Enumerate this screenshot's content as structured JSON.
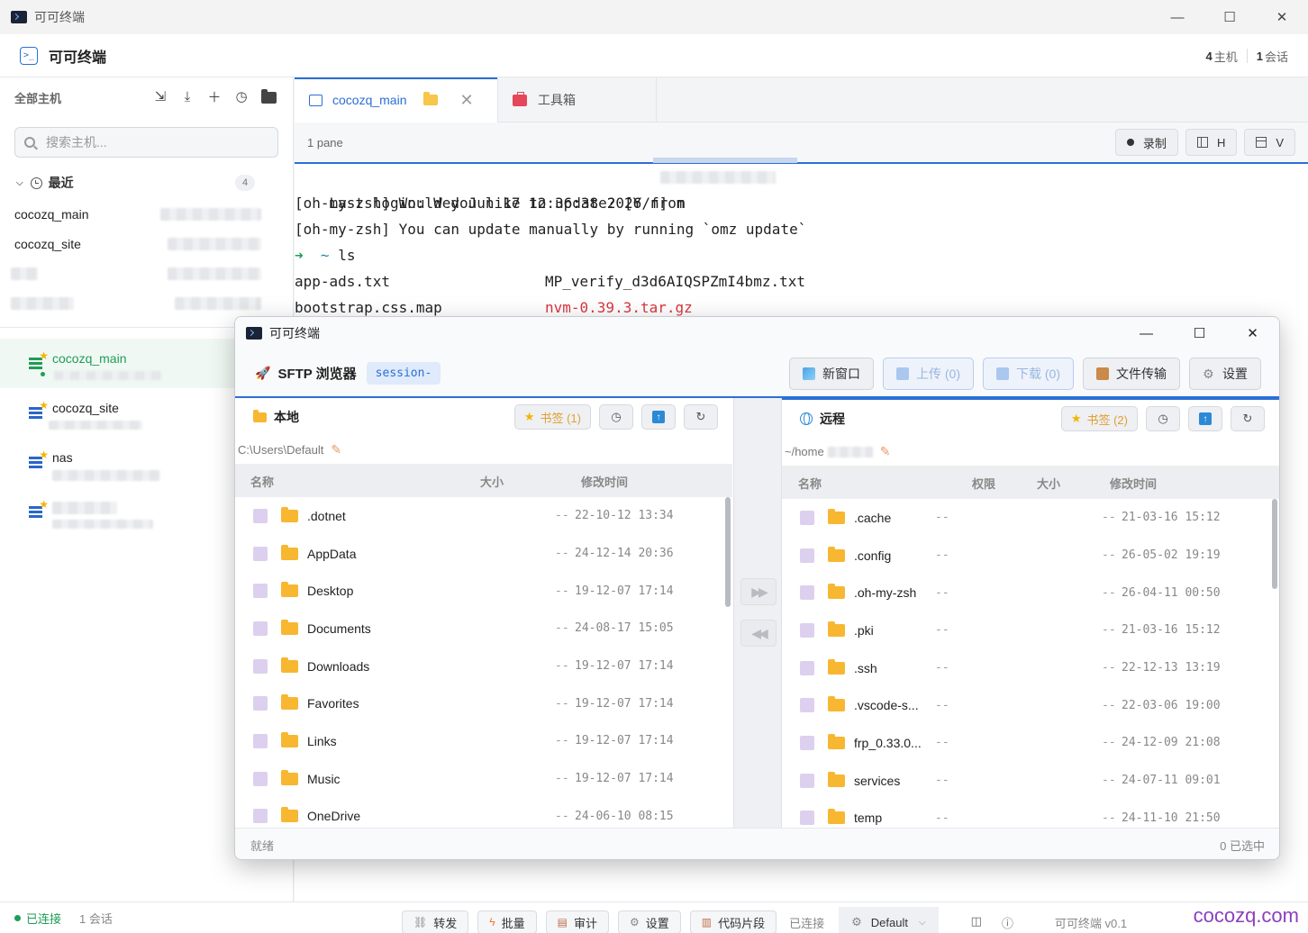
{
  "os": {
    "title": "可可终端",
    "minimize": "—",
    "maximize": "☐",
    "close": "✕"
  },
  "header": {
    "title": "可可终端",
    "hosts_count": "4",
    "hosts_label": "主机",
    "sessions_count": "1",
    "sessions_label": "会话"
  },
  "sidebar": {
    "title": "全部主机",
    "search_placeholder": "搜索主机...",
    "recent": {
      "label": "最近",
      "count": "4",
      "items": [
        "cocozq_main",
        "cocozq_site"
      ]
    },
    "hosts": [
      {
        "name": "cocozq_main"
      },
      {
        "name": "cocozq_site"
      },
      {
        "name": "nas"
      }
    ]
  },
  "tabs": [
    {
      "label": "cocozq_main"
    },
    {
      "label": "工具箱"
    }
  ],
  "panebar": {
    "label": "1 pane",
    "record": "录制",
    "h": "H",
    "v": "V"
  },
  "terminal": {
    "lines": [
      "Last login: Wed Jun 17 12:36:38 2026 from",
      "[oh-my-zsh] Would you like to update? [Y/n] n",
      "[oh-my-zsh] You can update manually by running `omz update`"
    ],
    "prompt_arrow": "➜",
    "prompt_dir": "~",
    "prompt_cmd": "ls",
    "files": [
      {
        "a": "app-ads.txt",
        "b": "MP_verify_d3d6AIQSPZmI4bmz.txt",
        "b_red": false
      },
      {
        "a": "bootstrap.css.map",
        "b": "nvm-0.39.3.tar.gz",
        "b_red": true
      }
    ]
  },
  "sftp": {
    "window_title": "可可终端",
    "title": "SFTP 浏览器",
    "session_badge": "session-",
    "actions": {
      "new_window": "新窗口",
      "upload": "上传 (0)",
      "download": "下载 (0)",
      "transfer": "文件传输",
      "settings": "设置"
    },
    "local": {
      "label": "本地",
      "bookmarks": "书签 (1)",
      "path": "C:\\Users\\Default",
      "cols": {
        "name": "名称",
        "size": "大小",
        "mtime": "修改时间"
      },
      "rows": [
        {
          "name": ".dotnet",
          "size": "--",
          "mtime": "22-10-12 13:34"
        },
        {
          "name": "AppData",
          "size": "--",
          "mtime": "24-12-14 20:36"
        },
        {
          "name": "Desktop",
          "size": "--",
          "mtime": "19-12-07 17:14"
        },
        {
          "name": "Documents",
          "size": "--",
          "mtime": "24-08-17 15:05"
        },
        {
          "name": "Downloads",
          "size": "--",
          "mtime": "19-12-07 17:14"
        },
        {
          "name": "Favorites",
          "size": "--",
          "mtime": "19-12-07 17:14"
        },
        {
          "name": "Links",
          "size": "--",
          "mtime": "19-12-07 17:14"
        },
        {
          "name": "Music",
          "size": "--",
          "mtime": "19-12-07 17:14"
        },
        {
          "name": "OneDrive",
          "size": "--",
          "mtime": "24-06-10 08:15"
        }
      ]
    },
    "remote": {
      "label": "远程",
      "bookmarks": "书签 (2)",
      "path": "~/home",
      "cols": {
        "name": "名称",
        "perm": "权限",
        "size": "大小",
        "mtime": "修改时间"
      },
      "rows": [
        {
          "name": ".cache",
          "perm": "--",
          "size": "--",
          "mtime": "21-03-16 15:12"
        },
        {
          "name": ".config",
          "perm": "--",
          "size": "--",
          "mtime": "26-05-02 19:19"
        },
        {
          "name": ".oh-my-zsh",
          "perm": "--",
          "size": "--",
          "mtime": "26-04-11 00:50"
        },
        {
          "name": ".pki",
          "perm": "--",
          "size": "--",
          "mtime": "21-03-16 15:12"
        },
        {
          "name": ".ssh",
          "perm": "--",
          "size": "--",
          "mtime": "22-12-13 13:19"
        },
        {
          "name": ".vscode-s...",
          "perm": "--",
          "size": "--",
          "mtime": "22-03-06 19:00"
        },
        {
          "name": "frp_0.33.0...",
          "perm": "--",
          "size": "--",
          "mtime": "24-12-09 21:08"
        },
        {
          "name": "services",
          "perm": "--",
          "size": "--",
          "mtime": "24-07-11 09:01"
        },
        {
          "name": "temp",
          "perm": "--",
          "size": "--",
          "mtime": "24-11-10 21:50"
        }
      ]
    },
    "status_left": "就绪",
    "status_right": "0 已选中"
  },
  "statusbar": {
    "connected": "已连接",
    "sessions": "1 会话",
    "forward": "转发",
    "batch": "批量",
    "audit": "审计",
    "settings": "设置",
    "snippets": "代码片段",
    "connected2": "已连接",
    "theme": "Default",
    "version": "可可终端 v0.1",
    "watermark": "cocozq.com"
  },
  "colors": {
    "accent": "#2b6fd6",
    "connected": "#1f9d57",
    "folder": "#f7b731",
    "bookmark_star": "#f5b400"
  }
}
